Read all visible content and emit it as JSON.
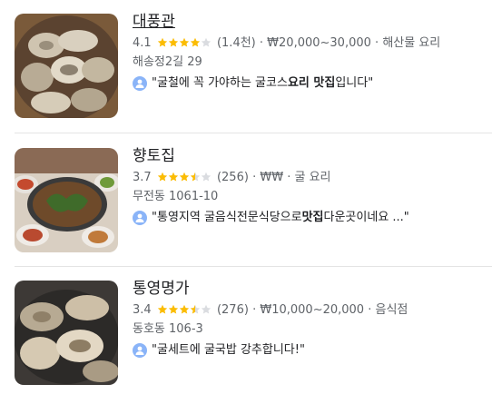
{
  "colors": {
    "star_filled": "#fbbc04",
    "star_empty": "#dadce0",
    "avatar": "#8ab4f8"
  },
  "places": [
    {
      "name": "대풍관",
      "rating": "4.1",
      "stars": 4.0,
      "reviews": "(1.4천)",
      "price": "₩20,000~30,000",
      "category": "해산물 요리",
      "address": "해송정2길 29",
      "review_pre": "\"굴철에 꼭 가야하는 굴코스",
      "review_bold": "요리 맛집",
      "review_post": "입니다\""
    },
    {
      "name": "향토집",
      "rating": "3.7",
      "stars": 3.5,
      "reviews": "(256)",
      "price": "₩₩",
      "category": "굴 요리",
      "address": "무전동 1061-10",
      "review_pre": "\"통영지역 굴음식전문식당으로 ",
      "review_bold": "맛집",
      "review_post": "다운곳이네요 ...\""
    },
    {
      "name": "통영명가",
      "rating": "3.4",
      "stars": 3.5,
      "reviews": "(276)",
      "price": "₩10,000~20,000",
      "category": "음식점",
      "address": "동호동 106-3",
      "review_pre": "\"굴세트에 굴국밥 강추합니다!\"",
      "review_bold": "",
      "review_post": ""
    }
  ],
  "separator": "·"
}
